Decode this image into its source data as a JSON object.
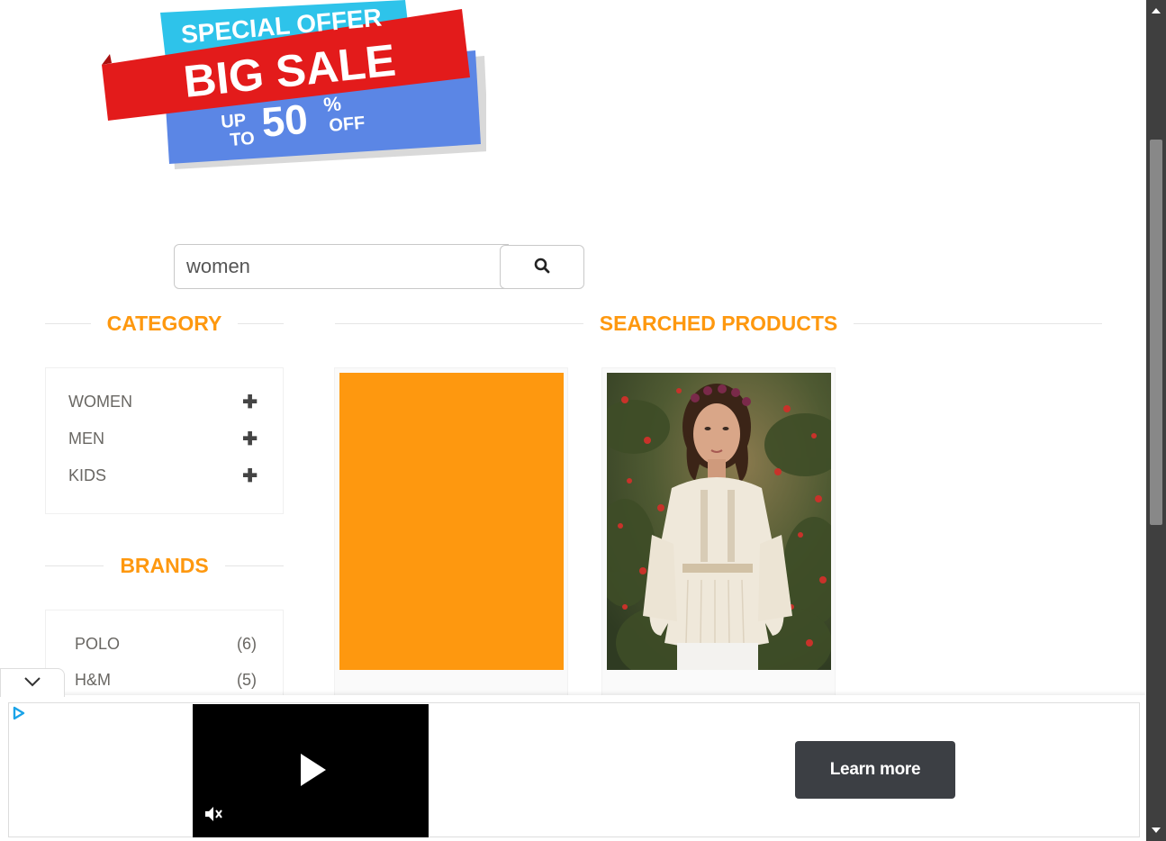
{
  "banner": {
    "line1": "SPECIAL OFFER",
    "line2": "BIG SALE",
    "line3_up": "UP",
    "line3_to": "TO",
    "line3_amount": "50",
    "line3_percent": "%",
    "line3_off": "OFF"
  },
  "search": {
    "value": "women"
  },
  "sidebar": {
    "category_title": "CATEGORY",
    "categories": [
      {
        "label": "WOMEN",
        "toggle": "✚"
      },
      {
        "label": "MEN",
        "toggle": "✚"
      },
      {
        "label": "KIDS",
        "toggle": "✚"
      }
    ],
    "brands_title": "BRANDS",
    "brands": [
      {
        "label": "POLO",
        "count": "(6)"
      },
      {
        "label": "H&M",
        "count": "(5)"
      }
    ]
  },
  "main": {
    "products_title": "SEARCHED PRODUCTS"
  },
  "ad": {
    "learn_more": "Learn more"
  },
  "colors": {
    "accent": "#fe980f",
    "ad_button": "#3c3f44"
  },
  "icons": {
    "search": "search-icon",
    "play": "play-icon",
    "mute": "mute-icon",
    "chevron": "chevron-down-icon",
    "ad_logo": "ad-choices-icon"
  }
}
